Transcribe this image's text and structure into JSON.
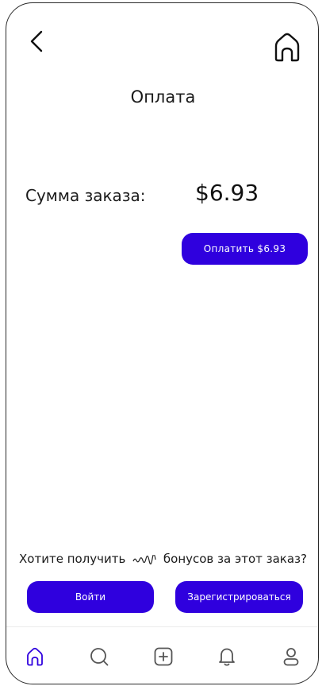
{
  "header": {
    "back_icon": "chevron-left-icon",
    "home_icon": "home-icon",
    "title": "Оплата"
  },
  "order": {
    "sum_label": "Сумма заказа:",
    "sum_value": "$6.93",
    "pay_button_label": "Оплатить $6.93"
  },
  "bonus": {
    "text_before": "Хотите получить",
    "text_after": "бонусов за этот заказ?",
    "login_label": "Войти",
    "register_label": "Зарегистрироваться"
  },
  "bottom_nav": {
    "items": [
      "home-icon",
      "search-icon",
      "add-icon",
      "bell-icon",
      "profile-icon"
    ],
    "active": "home-icon"
  },
  "colors": {
    "accent": "#2f00de",
    "text": "#1a1a1a",
    "nav_inactive": "#555555"
  }
}
